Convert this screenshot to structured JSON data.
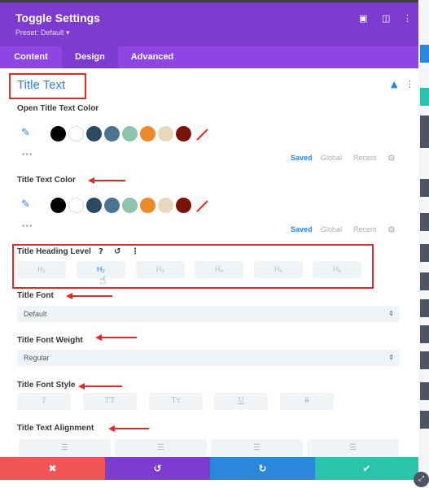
{
  "header": {
    "title": "Toggle Settings",
    "preset": "Preset: Default ▾",
    "icons": [
      "expand-icon",
      "columns-icon",
      "more-icon"
    ]
  },
  "tabs": [
    {
      "label": "Content",
      "active": false
    },
    {
      "label": "Design",
      "active": true
    },
    {
      "label": "Advanced",
      "active": false
    }
  ],
  "section": {
    "title": "Title Text"
  },
  "open_color": {
    "label": "Open Title Text Color",
    "swatches": [
      "#000000",
      "#ffffff",
      "#2b4a61",
      "#4d7390",
      "#8fc3ad",
      "#ec8a29",
      "#e7d8bd",
      "#7a1308",
      "clear"
    ],
    "dots": "•••",
    "tabs": [
      "Saved",
      "Global",
      "Recent"
    ]
  },
  "text_color": {
    "label": "Title Text Color",
    "swatches": [
      "#000000",
      "#ffffff",
      "#2b4a61",
      "#4d7390",
      "#8fc3ad",
      "#ec8a29",
      "#e7d8bd",
      "#7a1308",
      "clear"
    ],
    "dots": "•••",
    "tabs": [
      "Saved",
      "Global",
      "Recent"
    ]
  },
  "heading_level": {
    "label": "Title Heading Level",
    "help": "?",
    "reset": "↺",
    "more": "⋮",
    "options": [
      "H₁",
      "H₂",
      "H₃",
      "H₄",
      "H₅",
      "H₆"
    ],
    "selected": "H₂"
  },
  "font": {
    "label": "Title Font",
    "value": "Default"
  },
  "font_weight": {
    "label": "Title Font Weight",
    "value": "Regular"
  },
  "font_style": {
    "label": "Title Font Style",
    "options": [
      "I",
      "TT",
      "Tᴛ",
      "U",
      "S"
    ]
  },
  "alignment": {
    "label": "Title Text Alignment",
    "options": [
      "left",
      "center",
      "right",
      "justify"
    ]
  },
  "footer": {
    "cancel": "✖",
    "undo": "↺",
    "redo": "↻",
    "save": "✔"
  },
  "colors": {
    "purple": "#7e3bd0",
    "tabs": "#8e45e3",
    "accent": "#2f80ed",
    "red": "#ef5555",
    "undo": "#7e3bd0",
    "redo": "#2b87da",
    "save": "#29c4a9"
  }
}
